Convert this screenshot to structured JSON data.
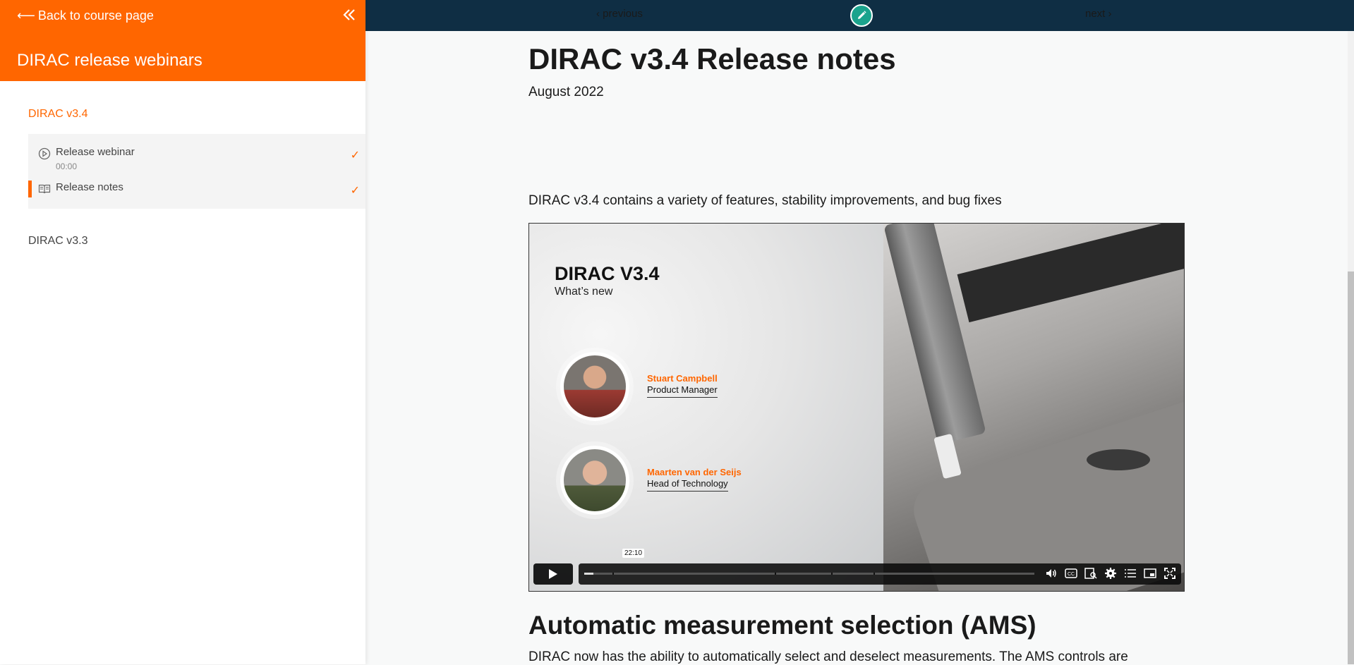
{
  "sidebar": {
    "back_label": "Back to course page",
    "course_title": "DIRAC release webinars",
    "sections": [
      {
        "title": "DIRAC v3.4",
        "lessons": [
          {
            "title": "Release webinar",
            "duration": "00:00",
            "completed": true,
            "icon": "play-circle-icon"
          },
          {
            "title": "Release notes",
            "completed": true,
            "active": true,
            "icon": "book-icon"
          }
        ]
      },
      {
        "title": "DIRAC v3.3"
      }
    ]
  },
  "topnav": {
    "previous_label": "‹ previous",
    "next_label": "next ›",
    "edit_icon": "pencil-icon"
  },
  "main": {
    "title": "DIRAC v3.4 Release notes",
    "date": "August 2022",
    "intro": "DIRAC v3.4 contains a variety of features, stability improvements, and bug fixes",
    "video": {
      "slide_title": "DIRAC V3.4",
      "slide_subtitle": "What’s new",
      "presenters": [
        {
          "name": "Stuart Campbell",
          "role": "Product Manager"
        },
        {
          "name": "Maarten van der Seijs",
          "role": "Head of Technology"
        }
      ],
      "hover_time": "22:10",
      "progress": 0.02
    },
    "section_heading": "Automatic measurement selection (AMS)",
    "section_text": "DIRAC now has the ability to automatically select and deselect measurements. The AMS controls are"
  },
  "colors": {
    "accent": "#ff6600",
    "topbar": "#0f2e44",
    "edit_button": "#1aa38d"
  }
}
